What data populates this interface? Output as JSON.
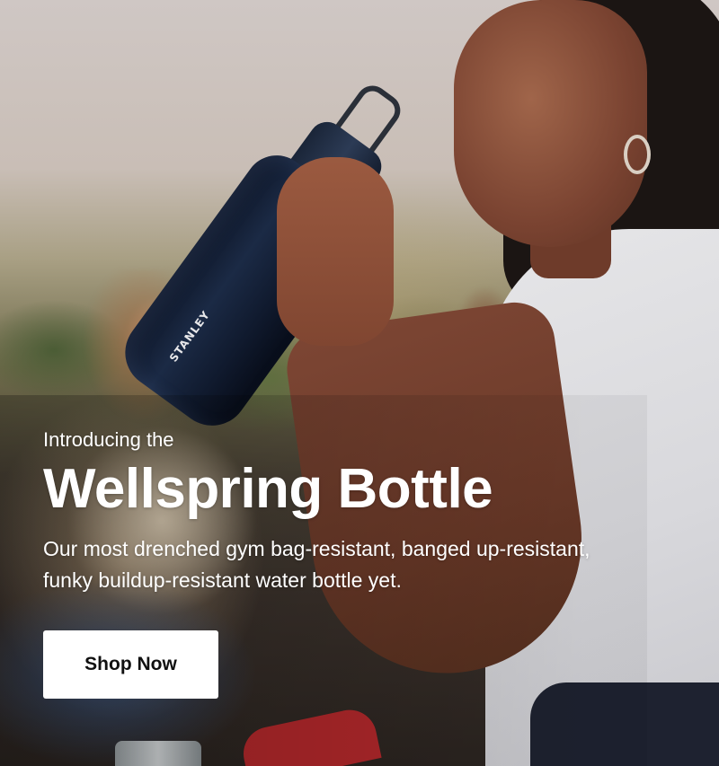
{
  "hero": {
    "eyebrow": "Introducing the",
    "headline": "Wellspring Bottle",
    "description": "Our most drenched gym bag-resistant, banged up-resistant, funky buildup-resistant water bottle yet.",
    "cta_label": "Shop Now",
    "bottle_logo": "STANLEY",
    "colors": {
      "text": "#ffffff",
      "button_bg": "#ffffff",
      "button_text": "#111111",
      "bottle": "#1b2a45"
    }
  }
}
